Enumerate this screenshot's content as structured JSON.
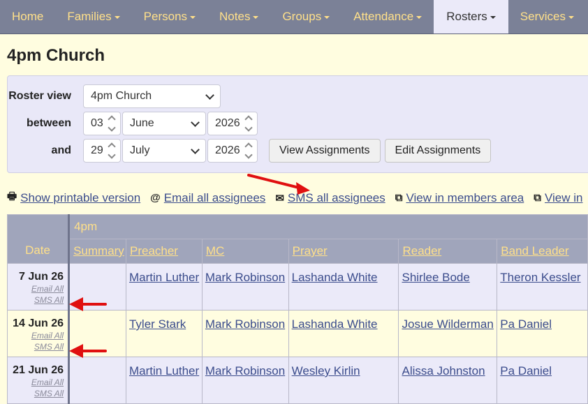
{
  "nav": {
    "items": [
      {
        "label": "Home",
        "dropdown": false,
        "active": false
      },
      {
        "label": "Families",
        "dropdown": true,
        "active": false
      },
      {
        "label": "Persons",
        "dropdown": true,
        "active": false
      },
      {
        "label": "Notes",
        "dropdown": true,
        "active": false
      },
      {
        "label": "Groups",
        "dropdown": true,
        "active": false
      },
      {
        "label": "Attendance",
        "dropdown": true,
        "active": false
      },
      {
        "label": "Rosters",
        "dropdown": true,
        "active": true
      },
      {
        "label": "Services",
        "dropdown": true,
        "active": false
      }
    ]
  },
  "page": {
    "title": "4pm Church"
  },
  "form": {
    "roster_view_label": "Roster view",
    "roster_view_value": "4pm Church",
    "between_label": "between",
    "and_label": "and",
    "from": {
      "day": "03",
      "month": "June",
      "year": "2026"
    },
    "to": {
      "day": "29",
      "month": "July",
      "year": "2026"
    },
    "view_button": "View Assignments",
    "edit_button": "Edit Assignments"
  },
  "actions": {
    "printable": "Show printable version",
    "email_all": "Email all assignees",
    "sms_all": "SMS all assignees",
    "members_area": "View in members area",
    "view_in": "View in"
  },
  "table": {
    "date_header": "Date",
    "service_name": "4pm",
    "columns": [
      "Summary",
      "Preacher",
      "MC",
      "Prayer",
      "Reader",
      "Band Leader"
    ],
    "email_link": "Email All",
    "sms_link": "SMS All",
    "rows": [
      {
        "date": "7 Jun 26",
        "cells": [
          "",
          "Martin Luther",
          "Mark Robinson",
          "Lashanda White",
          "Shirlee Bode",
          "Theron Kessler"
        ]
      },
      {
        "date": "14 Jun 26",
        "cells": [
          "",
          "Tyler Stark",
          "Mark Robinson",
          "Lashanda White",
          "Josue Wilderman",
          "Pa Daniel"
        ]
      },
      {
        "date": "21 Jun 26",
        "cells": [
          "",
          "Martin Luther",
          "Mark Robinson",
          "Wesley Kirlin",
          "Alissa Johnston",
          "Pa Daniel"
        ]
      }
    ]
  },
  "colors": {
    "nav_bg": "#7b8197",
    "nav_text": "#ffe08a",
    "page_bg": "#fffde0",
    "panel_bg": "#e9e8f8",
    "link": "#3b4c8c",
    "annotation_arrow": "#e01010"
  }
}
